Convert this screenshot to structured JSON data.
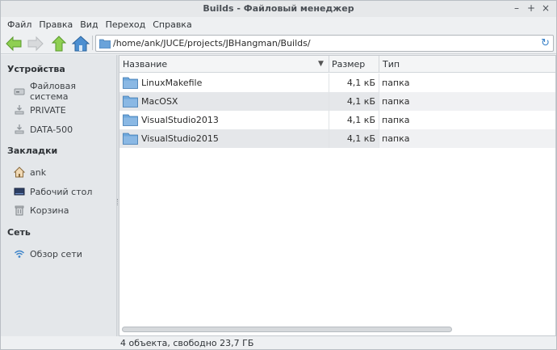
{
  "window": {
    "title": "Builds - Файловый менеджер",
    "controls": [
      "–",
      "+",
      "×"
    ]
  },
  "menubar": {
    "items": [
      "Файл",
      "Правка",
      "Вид",
      "Переход",
      "Справка"
    ]
  },
  "toolbar": {
    "back_icon": "arrow-left-icon",
    "forward_icon": "arrow-right-icon",
    "up_icon": "arrow-up-icon",
    "home_icon": "home-icon",
    "address": "/home/ank/JUCE/projects/JBHangman/Builds/",
    "reload_icon": "reload-icon",
    "reload_glyph": "↻"
  },
  "sidebar": {
    "devices_heading": "Устройства",
    "devices": [
      {
        "label": "Файловая система",
        "icon": "drive-icon"
      },
      {
        "label": "PRIVATE",
        "icon": "usb-drive-icon"
      },
      {
        "label": "DATA-500",
        "icon": "usb-drive-icon"
      }
    ],
    "bookmarks_heading": "Закладки",
    "bookmarks": [
      {
        "label": "ank",
        "icon": "home-icon"
      },
      {
        "label": "Рабочий стол",
        "icon": "desktop-icon"
      },
      {
        "label": "Корзина",
        "icon": "trash-icon"
      }
    ],
    "network_heading": "Сеть",
    "network": [
      {
        "label": "Обзор сети",
        "icon": "wifi-icon"
      }
    ]
  },
  "filelist": {
    "columns": {
      "name": "Название",
      "size": "Размер",
      "type": "Тип"
    },
    "sort_glyph": "▼",
    "rows": [
      {
        "name": "LinuxMakefile",
        "size": "4,1 кБ",
        "type": "папка"
      },
      {
        "name": "MacOSX",
        "size": "4,1 кБ",
        "type": "папка"
      },
      {
        "name": "VisualStudio2013",
        "size": "4,1 кБ",
        "type": "папка"
      },
      {
        "name": "VisualStudio2015",
        "size": "4,1 кБ",
        "type": "папка"
      }
    ]
  },
  "status": {
    "text": "4 объекта, свободно 23,7 ГБ"
  },
  "colors": {
    "folder": "#5b9bd5",
    "accent": "#3c83c9",
    "arrow_green": "#7cc242"
  }
}
